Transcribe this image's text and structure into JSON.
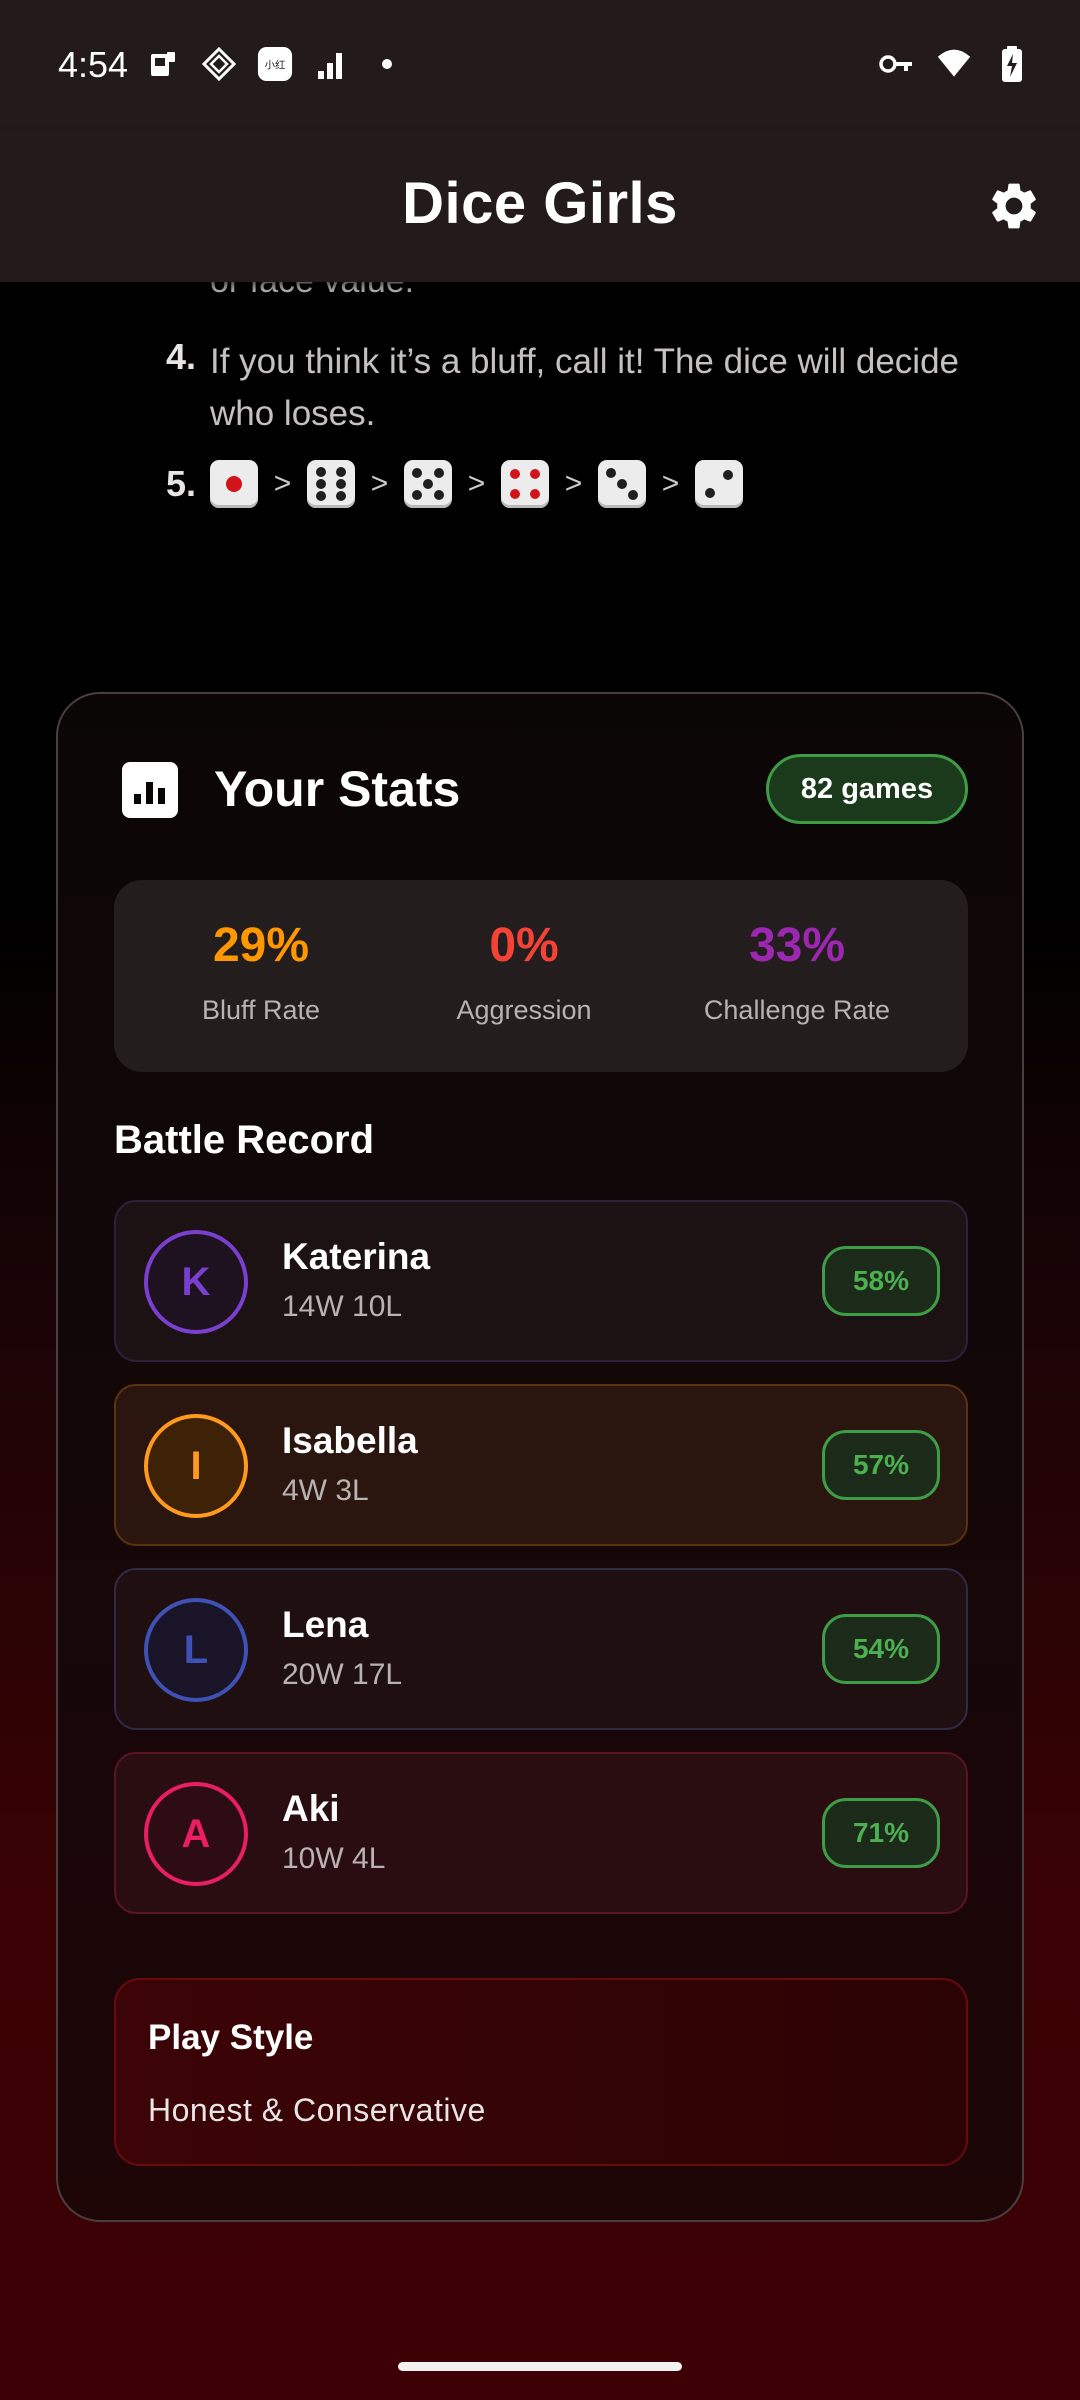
{
  "status_bar": {
    "time": "4:54",
    "left_icons": [
      "sim-card-icon",
      "diamond-app-icon",
      "app-badge-icon",
      "signal-icon",
      "dot-icon"
    ],
    "right_icons": [
      "vpn-key-icon",
      "wifi-icon",
      "battery-charging-icon"
    ]
  },
  "app_bar": {
    "title": "Dice Girls",
    "settings_icon": "gear-icon"
  },
  "rules": {
    "cut_text": "or face value.",
    "items": [
      {
        "num": "4.",
        "text": "If you think it’s a bluff, call it! The dice will decide who loses."
      },
      {
        "num": "5.",
        "dice_order": [
          1,
          6,
          5,
          4,
          3,
          2
        ],
        "separator": ">"
      }
    ]
  },
  "stats": {
    "title": "Your Stats",
    "games_badge": "82 games",
    "metrics": [
      {
        "value": "29%",
        "label": "Bluff Rate",
        "color": "#ff9800"
      },
      {
        "value": "0%",
        "label": "Aggression",
        "color": "#f44336"
      },
      {
        "value": "33%",
        "label": "Challenge Rate",
        "color": "#9c27b0"
      }
    ],
    "battle_title": "Battle Record",
    "opponents": [
      {
        "initial": "K",
        "name": "Katerina",
        "record": "14W 10L",
        "winrate": "58%",
        "color": "#7b3fd0",
        "bg": "#1c1214",
        "border": "#2e1f3a"
      },
      {
        "initial": "I",
        "name": "Isabella",
        "record": "4W 3L",
        "winrate": "57%",
        "color": "#ff9a1f",
        "bg": "#2a160e",
        "border": "#5a3210"
      },
      {
        "initial": "L",
        "name": "Lena",
        "record": "20W 17L",
        "winrate": "54%",
        "color": "#3f51b5",
        "bg": "#200f11",
        "border": "#2f2a45"
      },
      {
        "initial": "A",
        "name": "Aki",
        "record": "10W 4L",
        "winrate": "71%",
        "color": "#e91e63",
        "bg": "#2a0d10",
        "border": "#5a1422"
      }
    ],
    "play_style": {
      "title": "Play Style",
      "value": "Honest & Conservative"
    }
  }
}
